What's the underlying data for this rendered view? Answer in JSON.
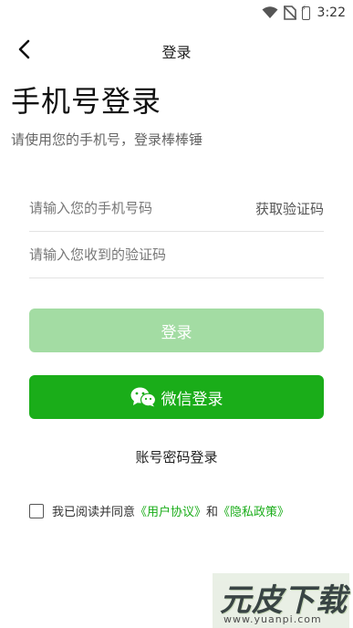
{
  "status_bar": {
    "time": "3:22",
    "icons": [
      "wifi-icon",
      "no-sim-icon",
      "battery-icon"
    ],
    "battery_label": "⚡"
  },
  "header": {
    "title": "登录",
    "back_icon": "back-arrow-icon"
  },
  "page": {
    "title": "手机号登录",
    "subtitle": "请使用您的手机号，登录棒棒锤"
  },
  "form": {
    "phone_placeholder": "请输入您的手机号码",
    "get_code_label": "获取验证码",
    "code_placeholder": "请输入您收到的验证码"
  },
  "buttons": {
    "login_label": "登录",
    "wechat_label": "微信登录",
    "account_login_label": "账号密码登录"
  },
  "agreement": {
    "prefix": "我已阅读并同意",
    "user_agreement": "《用户协议》",
    "and": "和",
    "privacy_policy": "《隐私政策》",
    "checked": false
  },
  "watermark": {
    "logo_text": "元皮下载",
    "url": "www.yuanpi.com"
  },
  "colors": {
    "accent": "#1aad19",
    "login_disabled": "#a3dca3"
  }
}
